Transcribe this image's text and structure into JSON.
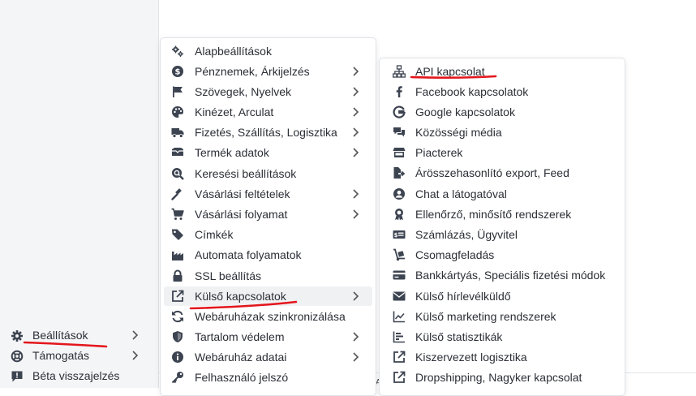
{
  "sidebar": {
    "items": [
      {
        "label": "Beállítások",
        "icon": "gear-icon",
        "has_submenu": true
      },
      {
        "label": "Támogatás",
        "icon": "lifebuoy-icon",
        "has_submenu": true
      },
      {
        "label": "Béta visszajelzés",
        "icon": "feedback-icon",
        "has_submenu": false
      }
    ]
  },
  "settings_menu": {
    "items": [
      {
        "label": "Alapbeállítások",
        "icon": "gears-icon",
        "has_submenu": false
      },
      {
        "label": "Pénznemek, Árkijelzés",
        "icon": "coin-icon",
        "has_submenu": true
      },
      {
        "label": "Szövegek, Nyelvek",
        "icon": "flag-icon",
        "has_submenu": true
      },
      {
        "label": "Kinézet, Arculat",
        "icon": "palette-icon",
        "has_submenu": true
      },
      {
        "label": "Fizetés, Szállítás, Logisztika",
        "icon": "truck-icon",
        "has_submenu": true
      },
      {
        "label": "Termék adatok",
        "icon": "box-icon",
        "has_submenu": true
      },
      {
        "label": "Keresési beállítások",
        "icon": "search-icon",
        "has_submenu": false
      },
      {
        "label": "Vásárlási feltételek",
        "icon": "gavel-icon",
        "has_submenu": true
      },
      {
        "label": "Vásárlási folyamat",
        "icon": "cart-icon",
        "has_submenu": true
      },
      {
        "label": "Címkék",
        "icon": "tag-icon",
        "has_submenu": false
      },
      {
        "label": "Automata folyamatok",
        "icon": "factory-icon",
        "has_submenu": false
      },
      {
        "label": "SSL beállítás",
        "icon": "lock-icon",
        "has_submenu": false
      },
      {
        "label": "Külső kapcsolatok",
        "icon": "external-link-icon",
        "has_submenu": true,
        "active": true
      },
      {
        "label": "Webáruházak szinkronizálása",
        "icon": "sync-icon",
        "has_submenu": false
      },
      {
        "label": "Tartalom védelem",
        "icon": "shield-icon",
        "has_submenu": true
      },
      {
        "label": "Webáruház adatai",
        "icon": "info-icon",
        "has_submenu": true
      },
      {
        "label": "Felhasználó jelszó",
        "icon": "key-icon",
        "has_submenu": false
      }
    ]
  },
  "external_menu": {
    "items": [
      {
        "label": "API kapcsolat",
        "icon": "sitemap-icon"
      },
      {
        "label": "Facebook kapcsolatok",
        "icon": "facebook-icon"
      },
      {
        "label": "Google kapcsolatok",
        "icon": "google-icon"
      },
      {
        "label": "Közösségi média",
        "icon": "comments-icon"
      },
      {
        "label": "Piacterek",
        "icon": "store-icon"
      },
      {
        "label": "Árösszehasonlító export, Feed",
        "icon": "file-export-icon"
      },
      {
        "label": "Chat a látogatóval",
        "icon": "user-circle-icon"
      },
      {
        "label": "Ellenőrző, minősítő rendszerek",
        "icon": "award-icon"
      },
      {
        "label": "Számlázás, Ügyvitel",
        "icon": "invoice-icon"
      },
      {
        "label": "Csomagfeladás",
        "icon": "dolly-icon"
      },
      {
        "label": "Bankkártyás, Speciális fizetési módok",
        "icon": "credit-card-icon"
      },
      {
        "label": "Külső hírlevélküldő",
        "icon": "envelope-icon"
      },
      {
        "label": "Külső marketing rendszerek",
        "icon": "chart-line-icon"
      },
      {
        "label": "Külső statisztikák",
        "icon": "chart-bar-icon"
      },
      {
        "label": "Kiszervezett logisztika",
        "icon": "external-link-icon"
      },
      {
        "label": "Dropshipping, Nagyker kapcsolat",
        "icon": "external-link-icon"
      }
    ]
  },
  "colors": {
    "annotation": "#e3161c",
    "icon": "#3d4451",
    "active_bg": "#f0f1f3"
  },
  "clipped_text": "A"
}
